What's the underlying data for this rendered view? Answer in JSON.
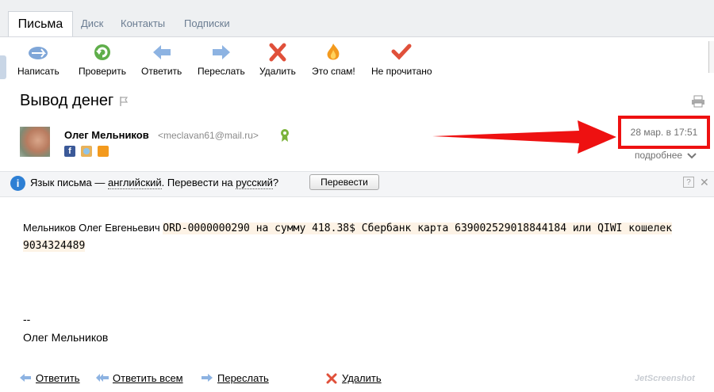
{
  "tabs": [
    {
      "label": "Письма",
      "active": true
    },
    {
      "label": "Диск",
      "active": false
    },
    {
      "label": "Контакты",
      "active": false
    },
    {
      "label": "Подписки",
      "active": false
    }
  ],
  "toolbar": {
    "compose": "Написать",
    "check": "Проверить",
    "reply": "Ответить",
    "forward": "Переслать",
    "delete": "Удалить",
    "spam": "Это спам!",
    "unread": "Не прочитано"
  },
  "message": {
    "subject": "Вывод денег",
    "sender_name": "Олег Мельников",
    "sender_email": "<meclavan61@mail.ru>",
    "date": "28 мар. в 17:51",
    "more": "подробнее",
    "body_prefix": "Мельников Олег Евгеньевич ",
    "body_line1": "ORD-0000000290 на сумму 418.38$ Сбербанк карта 639002529018844184 или QIWI кошелек",
    "body_line2": "9034324489",
    "signature_dash": "--",
    "signature_name": "Олег Мельников"
  },
  "language_bar": {
    "prefix": "Язык письма — ",
    "language": "английский",
    "middle": ". Перевести на ",
    "target": "русский",
    "suffix": "?",
    "button": "Перевести"
  },
  "actions": {
    "reply": "Ответить",
    "reply_all": "Ответить всем",
    "forward": "Переслать",
    "delete": "Удалить"
  },
  "watermark": "JetScreenshot",
  "colors": {
    "highlight": "#ee1111",
    "tab_bg": "#eef0f2",
    "link": "#000000"
  }
}
